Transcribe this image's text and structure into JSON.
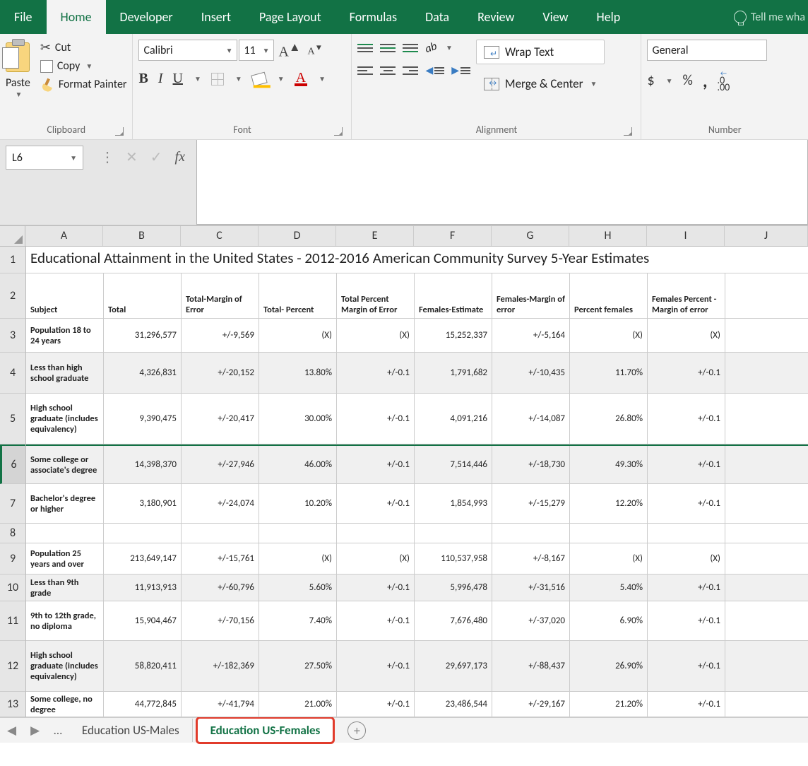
{
  "tabs": {
    "file": "File",
    "home": "Home",
    "developer": "Developer",
    "insert": "Insert",
    "pageLayout": "Page Layout",
    "formulas": "Formulas",
    "data": "Data",
    "review": "Review",
    "view": "View",
    "help": "Help",
    "tellme": "Tell me wha"
  },
  "ribbon": {
    "clipboard": {
      "paste": "Paste",
      "cut": "Cut",
      "copy": "Copy",
      "formatPainter": "Format Painter",
      "label": "Clipboard"
    },
    "font": {
      "name": "Calibri",
      "size": "11",
      "label": "Font"
    },
    "alignment": {
      "wrap": "Wrap Text",
      "merge": "Merge & Center",
      "label": "Alignment"
    },
    "number": {
      "format": "General",
      "label": "Number",
      "dollar": "$",
      "pct": "%",
      "comma": ",",
      "decInc": "←.0\n.00",
      "decDec": ".00\n→.0"
    }
  },
  "formulaBar": {
    "name": "L6",
    "fx": "fx"
  },
  "columns": [
    "A",
    "B",
    "C",
    "D",
    "E",
    "F",
    "G",
    "H",
    "I",
    "J"
  ],
  "rownums": [
    "1",
    "2",
    "3",
    "4",
    "5",
    "6",
    "7",
    "8",
    "9",
    "10",
    "11",
    "12",
    "13"
  ],
  "grid": {
    "title": "Educational Attainment in the United States - 2012-2016 American Community Survey 5-Year Estimates",
    "headers": {
      "A": "Subject",
      "B": "Total",
      "C": "Total-Margin of Error",
      "D": "Total- Percent",
      "E": "Total Percent Margin of Error",
      "F": "Females-Estimate",
      "G": "Females-Margin of error",
      "H": "Percent females",
      "I": "Females Percent - Margin of error"
    },
    "r3": {
      "A": "Population 18 to 24 years",
      "B": "31,296,577",
      "C": "+/-9,569",
      "D": "(X)",
      "E": "(X)",
      "F": "15,252,337",
      "G": "+/-5,164",
      "H": "(X)",
      "I": "(X)"
    },
    "r4": {
      "A": "Less than high school graduate",
      "B": "4,326,831",
      "C": "+/-20,152",
      "D": "13.80%",
      "E": "+/-0.1",
      "F": "1,791,682",
      "G": "+/-10,435",
      "H": "11.70%",
      "I": "+/-0.1"
    },
    "r5": {
      "A": "High school graduate (includes equivalency)",
      "B": "9,390,475",
      "C": "+/-20,417",
      "D": "30.00%",
      "E": "+/-0.1",
      "F": "4,091,216",
      "G": "+/-14,087",
      "H": "26.80%",
      "I": "+/-0.1"
    },
    "r6": {
      "A": "Some college or associate's degree",
      "B": "14,398,370",
      "C": "+/-27,946",
      "D": "46.00%",
      "E": "+/-0.1",
      "F": "7,514,446",
      "G": "+/-18,730",
      "H": "49.30%",
      "I": "+/-0.1"
    },
    "r7": {
      "A": "Bachelor's degree or higher",
      "B": "3,180,901",
      "C": "+/-24,074",
      "D": "10.20%",
      "E": "+/-0.1",
      "F": "1,854,993",
      "G": "+/-15,279",
      "H": "12.20%",
      "I": "+/-0.1"
    },
    "r9": {
      "A": "Population 25 years and over",
      "B": "213,649,147",
      "C": "+/-15,761",
      "D": "(X)",
      "E": "(X)",
      "F": "110,537,958",
      "G": "+/-8,167",
      "H": "(X)",
      "I": "(X)"
    },
    "r10": {
      "A": "Less than 9th grade",
      "B": "11,913,913",
      "C": "+/-60,796",
      "D": "5.60%",
      "E": "+/-0.1",
      "F": "5,996,478",
      "G": "+/-31,516",
      "H": "5.40%",
      "I": "+/-0.1"
    },
    "r11": {
      "A": "9th to 12th grade, no diploma",
      "B": "15,904,467",
      "C": "+/-70,156",
      "D": "7.40%",
      "E": "+/-0.1",
      "F": "7,676,480",
      "G": "+/-37,020",
      "H": "6.90%",
      "I": "+/-0.1"
    },
    "r12": {
      "A": "High school graduate (includes equivalency)",
      "B": "58,820,411",
      "C": "+/-182,369",
      "D": "27.50%",
      "E": "+/-0.1",
      "F": "29,697,173",
      "G": "+/-88,437",
      "H": "26.90%",
      "I": "+/-0.1"
    },
    "r13": {
      "A": "Some college, no degree",
      "B": "44,772,845",
      "C": "+/-41,794",
      "D": "21.00%",
      "E": "+/-0.1",
      "F": "23,486,544",
      "G": "+/-29,167",
      "H": "21.20%",
      "I": "+/-0.1"
    }
  },
  "sheetTabs": {
    "males": "Education US-Males",
    "females": "Education US-Females"
  }
}
